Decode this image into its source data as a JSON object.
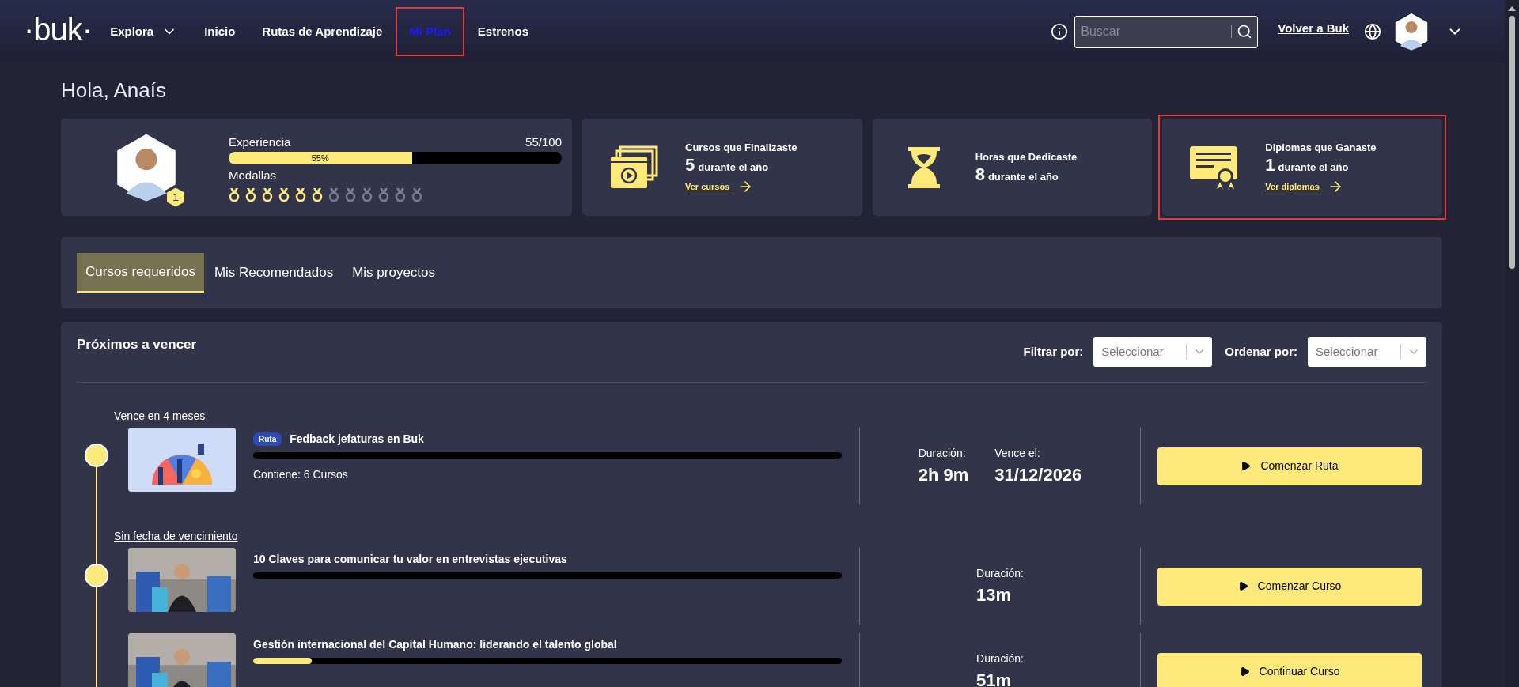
{
  "nav": {
    "logo": "·buk·",
    "items": [
      {
        "label": "Explora",
        "kind": "dropdown",
        "selected": false,
        "highlighted": false
      },
      {
        "label": "Inicio",
        "kind": "link",
        "selected": false,
        "highlighted": false
      },
      {
        "label": "Rutas de Aprendizaje",
        "kind": "link",
        "selected": false,
        "highlighted": false
      },
      {
        "label": "Mi Plan",
        "kind": "link",
        "selected": true,
        "highlighted": true
      },
      {
        "label": "Estrenos",
        "kind": "link",
        "selected": false,
        "highlighted": false
      }
    ],
    "search": {
      "placeholder": "Buscar"
    },
    "back_link": "Volver a Buk"
  },
  "greeting": "Hola, Anaís",
  "profile": {
    "badge": "1",
    "experience_label": "Experiencia",
    "experience_value": "55/100",
    "level": 0.55,
    "percent": "55%",
    "medals_label": "Medallas",
    "medals": [
      {
        "earned": true
      },
      {
        "earned": true
      },
      {
        "earned": true
      },
      {
        "earned": true
      },
      {
        "earned": true
      },
      {
        "earned": true
      },
      {
        "earned": false
      },
      {
        "earned": false
      },
      {
        "earned": false
      },
      {
        "earned": false
      },
      {
        "earned": false
      },
      {
        "earned": false
      }
    ]
  },
  "stats": [
    {
      "kind": "courses",
      "title": "Cursos que Finalizaste",
      "count": "5",
      "suffix": "durante el año",
      "link": "Ver cursos",
      "highlighted": false
    },
    {
      "kind": "hours",
      "title": "Horas que Dedicaste",
      "count": "8",
      "suffix": "durante el año",
      "highlighted": false
    },
    {
      "kind": "diplomas",
      "title": "Diplomas que Ganaste",
      "count": "1",
      "suffix": "durante el año",
      "link": "Ver diplomas",
      "highlighted": true
    }
  ],
  "tabs": [
    {
      "label": "Cursos requeridos",
      "selected": true
    },
    {
      "label": "Mis Recomendados",
      "selected": false
    },
    {
      "label": "Mis proyectos",
      "selected": false
    }
  ],
  "list": {
    "title": "Próximos a vencer",
    "filter_label": "Filtrar por:",
    "filter_placeholder": "Seleccionar",
    "sort_label": "Ordenar por:",
    "sort_placeholder": "Seleccionar",
    "groups": [
      {
        "label": "Vence en 4 meses",
        "items": [
          {
            "kind": "illustration",
            "tag": "Ruta",
            "title": "Fedback jefaturas en Buk",
            "level": 0,
            "contains": "Contiene: 6 Cursos",
            "duration_label": "Duración:",
            "duration": "2h 9m",
            "due_label": "Vence el:",
            "due": "31/12/2026",
            "button": "Comenzar Ruta"
          }
        ]
      },
      {
        "label": "Sin fecha de vencimiento",
        "items": [
          {
            "title": "10 Claves para comunicar tu valor en entrevistas ejecutivas",
            "level": 0,
            "duration_label": "Duración:",
            "duration": "13m",
            "button": "Comenzar Curso"
          },
          {
            "title": "Gestión internacional del Capital Humano: liderando el talento global",
            "level": 0.1,
            "duration_label": "Duración:",
            "duration": "51m",
            "button": "Continuar Curso"
          }
        ]
      }
    ]
  }
}
